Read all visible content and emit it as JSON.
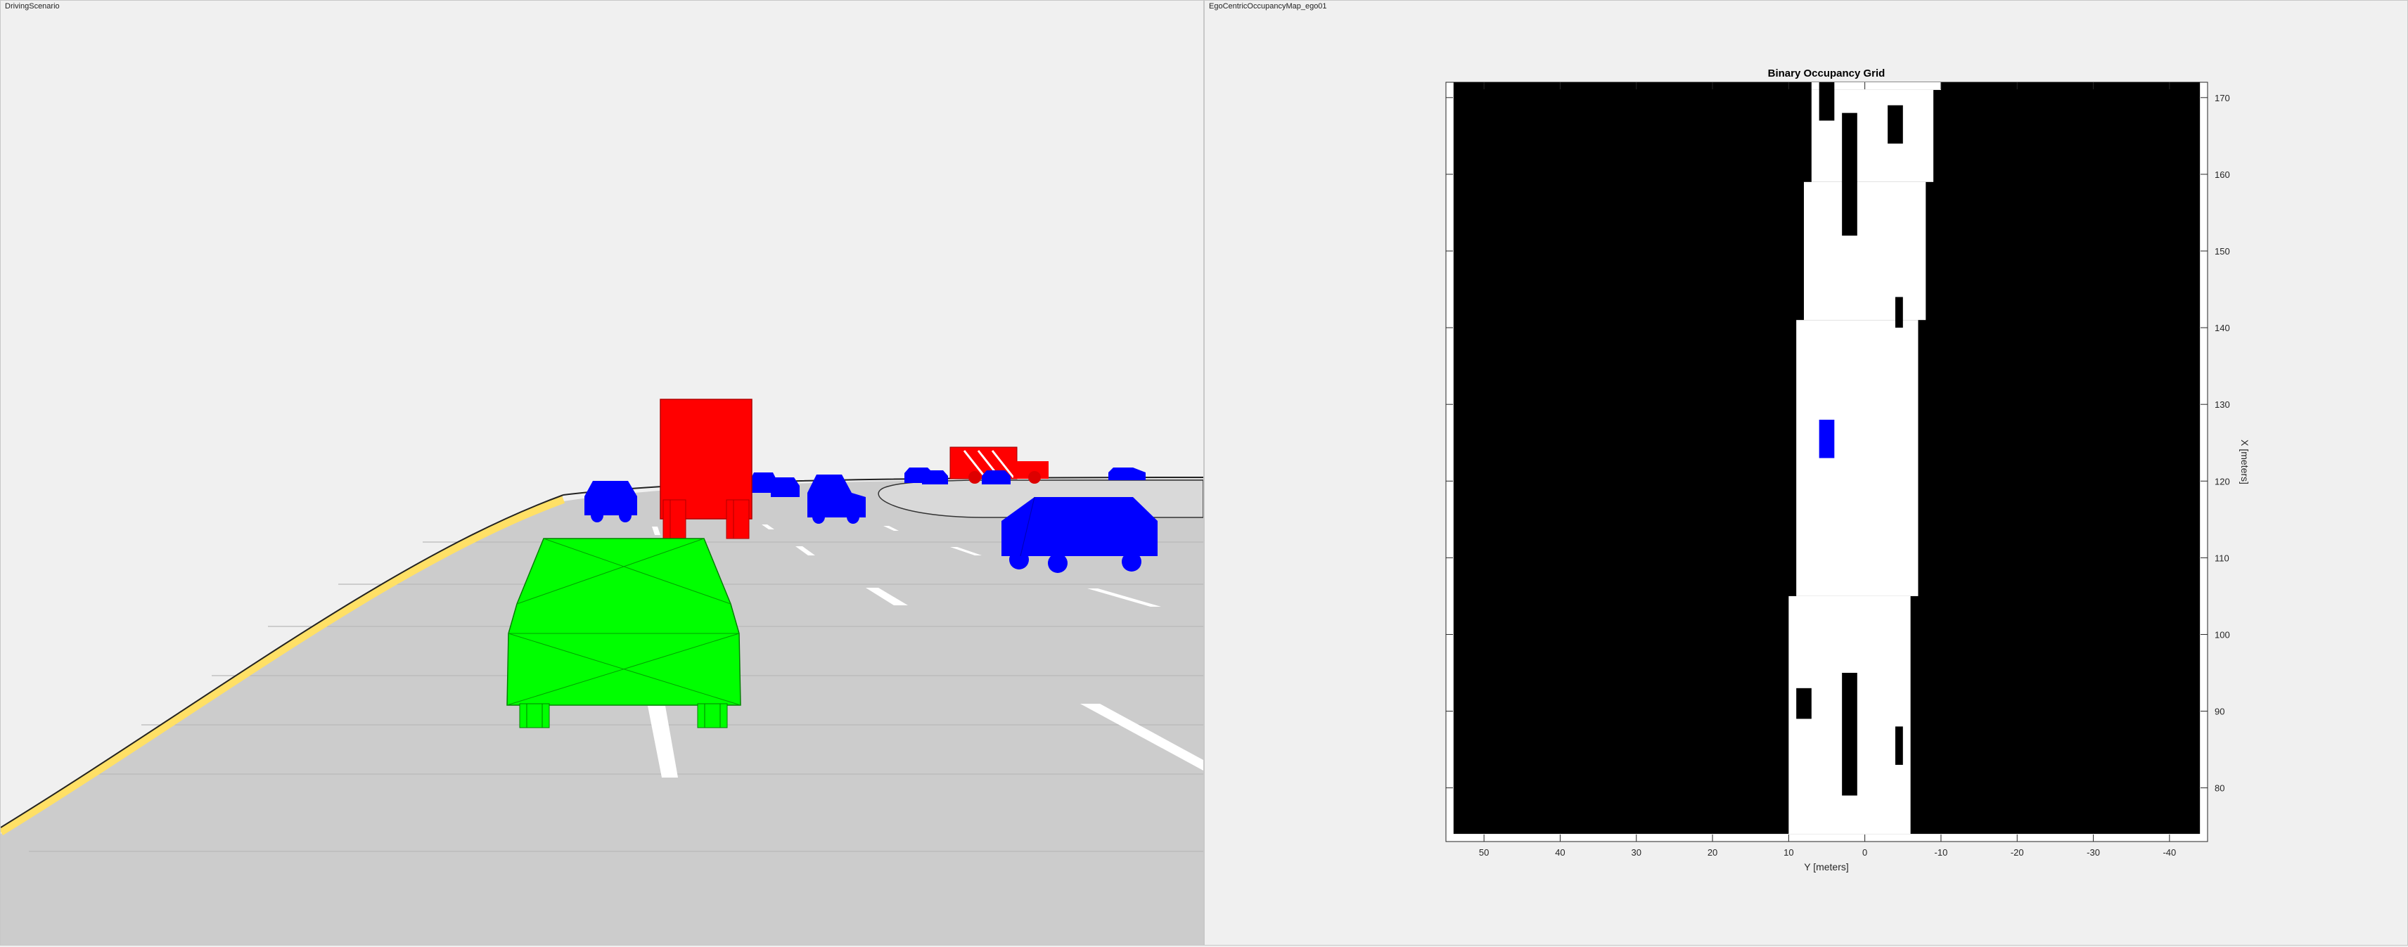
{
  "window": {
    "left_title": "DrivingScenario",
    "right_title": "EgoCentricOccupancyMap_ego01"
  },
  "colors": {
    "ego": "#00ff00",
    "truck": "#ff0000",
    "car": "#0000ff",
    "road": "#cccccc",
    "road_edge": "#ffe066",
    "background": "#f0f0f0"
  },
  "scene": {
    "vehicles": [
      {
        "kind": "ego",
        "color": "green"
      },
      {
        "kind": "truck",
        "color": "red"
      },
      {
        "kind": "car",
        "color": "blue"
      },
      {
        "kind": "car",
        "color": "blue"
      },
      {
        "kind": "car",
        "color": "blue"
      },
      {
        "kind": "car",
        "color": "blue"
      },
      {
        "kind": "car",
        "color": "blue"
      },
      {
        "kind": "truck",
        "color": "red"
      },
      {
        "kind": "car",
        "color": "blue"
      },
      {
        "kind": "car",
        "color": "blue"
      }
    ]
  },
  "chart_data": {
    "type": "heatmap",
    "title": "Binary Occupancy Grid",
    "xlabel": "Y [meters]",
    "ylabel": "X [meters]",
    "xlim": [
      55,
      -45
    ],
    "ylim": [
      73,
      172
    ],
    "x_ticks": [
      50,
      40,
      30,
      20,
      10,
      0,
      -10,
      -20,
      -30,
      -40
    ],
    "x_tick_labels": [
      "50",
      "40",
      "30",
      "20",
      "10",
      "0",
      "-10",
      "-20",
      "-30",
      "-40"
    ],
    "y_ticks": [
      80,
      90,
      100,
      110,
      120,
      130,
      140,
      150,
      160,
      170
    ],
    "y_tick_labels": [
      "80",
      "90",
      "100",
      "110",
      "120",
      "130",
      "140",
      "150",
      "160",
      "170"
    ],
    "grid_extent": {
      "y": [
        54,
        -44
      ],
      "x": [
        74,
        172
      ]
    },
    "free_corridor_edges": [
      {
        "x_from": 74,
        "x_to": 105,
        "left_y": 10,
        "right_y": -6
      },
      {
        "x_from": 105,
        "x_to": 141,
        "left_y": 9,
        "right_y": -7
      },
      {
        "x_from": 141,
        "x_to": 159,
        "left_y": 8,
        "right_y": -8
      },
      {
        "x_from": 159,
        "x_to": 171,
        "left_y": 7,
        "right_y": -9
      },
      {
        "x_from": 171,
        "x_to": 172,
        "left_y": 7,
        "right_y": -10
      }
    ],
    "occupied_cells": [
      {
        "y": [
          9,
          7
        ],
        "x": [
          89,
          93
        ]
      },
      {
        "y": [
          3,
          1
        ],
        "x": [
          79,
          95
        ]
      },
      {
        "y": [
          -4,
          -5
        ],
        "x": [
          83,
          88
        ]
      },
      {
        "y": [
          -4,
          -5
        ],
        "x": [
          140,
          144
        ]
      },
      {
        "y": [
          3,
          1
        ],
        "x": [
          152,
          168
        ]
      },
      {
        "y": [
          -3,
          -5
        ],
        "x": [
          164,
          169
        ]
      },
      {
        "y": [
          6,
          4
        ],
        "x": [
          167,
          172
        ]
      }
    ],
    "ego_marker": {
      "y": [
        6,
        4
      ],
      "x": [
        123,
        128
      ],
      "color": "#0000ff"
    },
    "grid": false,
    "legend": "none"
  }
}
